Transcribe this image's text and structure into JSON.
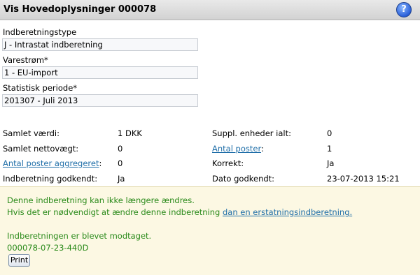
{
  "header": {
    "title": "Vis Hovedoplysninger 000078",
    "help_icon": "question-mark-icon"
  },
  "fields": {
    "type_label": "Indberetningstype",
    "type_value": "J - Intrastat indberetning",
    "flow_label": "Varestrøm*",
    "flow_value": "1 - EU-import",
    "period_label": "Statistisk periode*",
    "period_value": "201307 - Juli 2013"
  },
  "summary": {
    "samlet_vaerdi_label": "Samlet værdi:",
    "samlet_vaerdi_value": "1 DKK",
    "suppl_label": "Suppl. enheder ialt:",
    "suppl_value": "0",
    "nettovaegt_label": "Samlet nettovægt:",
    "nettovaegt_value": "0",
    "antal_poster_label": "Antal poster",
    "antal_poster_value": "1",
    "aggregeret_label": "Antal poster aggregeret",
    "aggregeret_value": "0",
    "korrekt_label": "Korrekt:",
    "korrekt_value": "Ja",
    "godkendt_label": "Indberetning godkendt:",
    "godkendt_value": "Ja",
    "dato_label": "Dato godkendt:",
    "dato_value": "23-07-2013 15:21"
  },
  "info": {
    "line1": "Denne indberetning kan ikke længere ændres.",
    "line2_prefix": "Hvis det er nødvendigt at ændre denne indberetning ",
    "line2_link": "dan en erstatningsindberetning.",
    "line3": "Indberetningen er blevet modtaget.",
    "line4": "000078-07-23-440D",
    "print_label": "Print"
  }
}
